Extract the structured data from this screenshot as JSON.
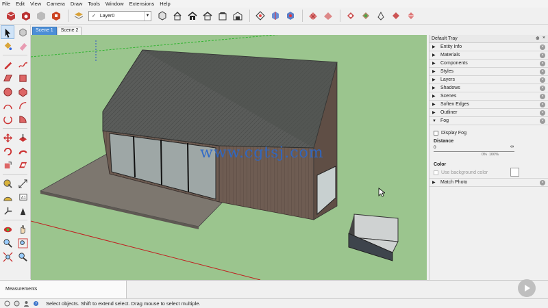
{
  "menu": [
    "File",
    "Edit",
    "View",
    "Camera",
    "Draw",
    "Tools",
    "Window",
    "Extensions",
    "Help"
  ],
  "toolbar": {
    "layer_check": "✓",
    "layer_name": "Layer0"
  },
  "scenes": [
    {
      "label": "Scene 1",
      "active": true
    },
    {
      "label": "Scene 2",
      "active": false
    }
  ],
  "viewport": {
    "watermark": "www.cgtsj.com",
    "background_color": "#9bc58e"
  },
  "tray": {
    "title": "Default Tray",
    "pin": "⊕",
    "close": "×",
    "panels": [
      "Entity Info",
      "Materials",
      "Components",
      "Styles",
      "Layers",
      "Shadows",
      "Scenes",
      "Soften Edges",
      "Outliner"
    ],
    "fog": {
      "label": "Fog",
      "display_fog": "Display Fog",
      "distance": "Distance",
      "slider_min": "0",
      "slider_max": "∞",
      "pct_0": "0%",
      "pct_100": "100%",
      "color": "Color",
      "use_bg": "Use background color"
    },
    "match_photo": "Match Photo"
  },
  "measurements": {
    "label": "Measurements"
  },
  "status": {
    "text": "Select objects. Shift to extend select. Drag mouse to select multiple."
  }
}
